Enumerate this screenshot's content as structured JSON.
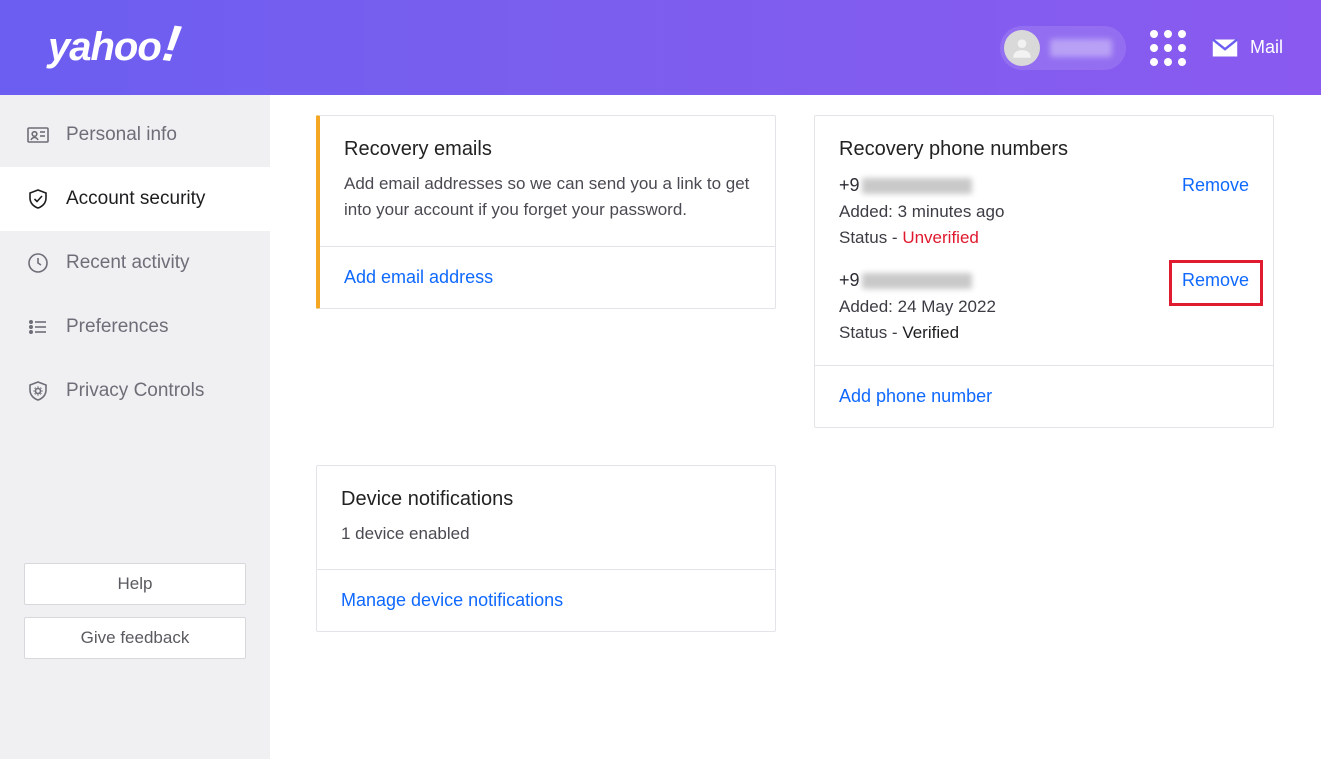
{
  "header": {
    "logo_text": "yahoo",
    "mail_label": "Mail"
  },
  "sidebar": {
    "items": [
      {
        "label": "Personal info"
      },
      {
        "label": "Account security"
      },
      {
        "label": "Recent activity"
      },
      {
        "label": "Preferences"
      },
      {
        "label": "Privacy Controls"
      }
    ],
    "help_label": "Help",
    "feedback_label": "Give feedback"
  },
  "recovery_emails": {
    "title": "Recovery emails",
    "description": "Add email addresses so we can send you a link to get into your account if you forget your password.",
    "action": "Add email address"
  },
  "device_notifications": {
    "title": "Device notifications",
    "status": "1 device enabled",
    "action": "Manage device notifications"
  },
  "recovery_phones": {
    "title": "Recovery phone numbers",
    "entries": [
      {
        "prefix": "+9",
        "added_label": "Added:",
        "added_value": "3 minutes ago",
        "status_label": "Status -",
        "status_value": "Unverified",
        "remove_label": "Remove"
      },
      {
        "prefix": "+9",
        "added_label": "Added:",
        "added_value": "24 May 2022",
        "status_label": "Status -",
        "status_value": "Verified",
        "remove_label": "Remove"
      }
    ],
    "action": "Add phone number"
  }
}
